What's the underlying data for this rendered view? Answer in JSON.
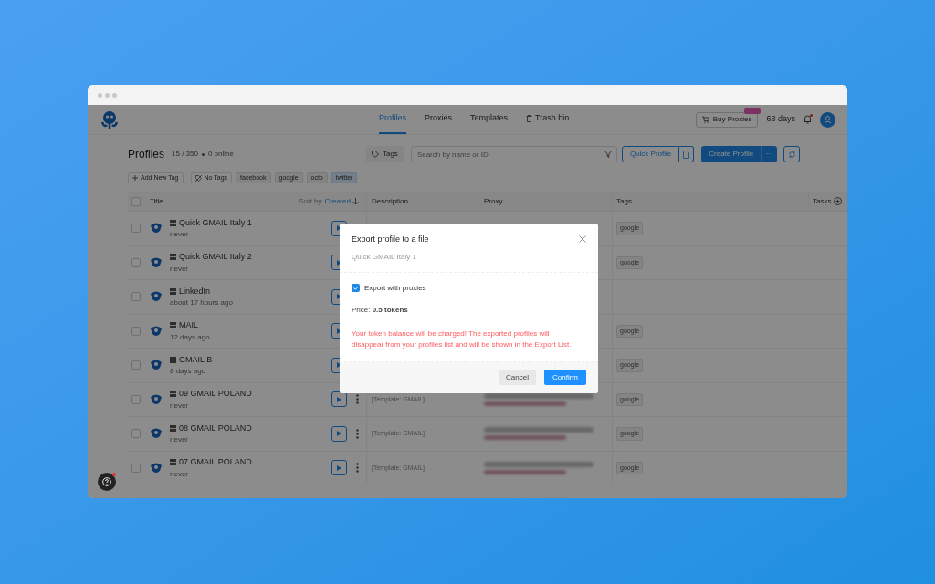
{
  "nav": [
    {
      "label": "Profiles",
      "selected": true,
      "kind": "link"
    },
    {
      "label": "Proxies",
      "selected": false,
      "kind": "link"
    },
    {
      "label": "Templates",
      "selected": false,
      "kind": "link"
    },
    {
      "label": "Trash bin",
      "selected": false,
      "kind": "trash"
    }
  ],
  "header": {
    "buy_button": "Buy Proxies",
    "days": "68 days",
    "notification": true
  },
  "toolbar": {
    "title": "Profiles",
    "count": "15 / 350",
    "online": "0 online",
    "tags_button": "Tags",
    "search": {
      "placeholder": "Search by name or ID"
    },
    "quick_button": "Quick Profile",
    "create_button": "Create Profile",
    "more": "···"
  },
  "tag_filters": {
    "add": "Add New Tag",
    "none": "No Tags",
    "tags": [
      {
        "label": "facebook",
        "selected": false
      },
      {
        "label": "google",
        "selected": false
      },
      {
        "label": "octo",
        "selected": false
      },
      {
        "label": "twitter",
        "selected": true
      }
    ]
  },
  "table": {
    "columns": {
      "title": "Title",
      "sort_prefix": "Sort by",
      "sort_field": "Created",
      "description": "Description",
      "proxy": "Proxy",
      "tags": "Tags",
      "tasks": "Tasks"
    },
    "all_checked": false,
    "rows": [
      {
        "checked": false,
        "name": "Quick GMAIL Italy 1",
        "time": "never",
        "tags": [
          "google"
        ]
      },
      {
        "checked": false,
        "name": "Quick GMAIL Italy 2",
        "time": "never",
        "tags": [
          "google"
        ]
      },
      {
        "checked": false,
        "name": "LinkedIn",
        "time": "about 17 hours ago",
        "tags": []
      },
      {
        "checked": false,
        "name": "MAIL",
        "time": "12 days ago",
        "tags": [
          "google"
        ]
      },
      {
        "checked": false,
        "name": "GMAIL B",
        "time": "8 days ago",
        "tags": [
          "google"
        ]
      },
      {
        "checked": false,
        "name": "09 GMAIL POLAND",
        "time": "never",
        "description": "[Template: GMAIL]",
        "tags": [
          "google"
        ]
      },
      {
        "checked": false,
        "name": "08 GMAIL POLAND",
        "time": "never",
        "description": "[Template: GMAIL]",
        "tags": [
          "google"
        ]
      },
      {
        "checked": false,
        "name": "07 GMAIL POLAND",
        "time": "never",
        "description": "[Template: GMAIL]",
        "tags": [
          "google"
        ]
      }
    ]
  },
  "dialog": {
    "title": "Export profile to a file",
    "subtitle": "Quick GMAIL Italy 1",
    "checkbox": {
      "label": "Export with proxies",
      "checked": true
    },
    "price": "Price: **0.5 tokens**",
    "warning": "Your token balance will be charged! The exported profiles will disappear from your profiles list and will be shown in the Export List.",
    "cancel": "Cancel",
    "confirm": "Confirm"
  }
}
